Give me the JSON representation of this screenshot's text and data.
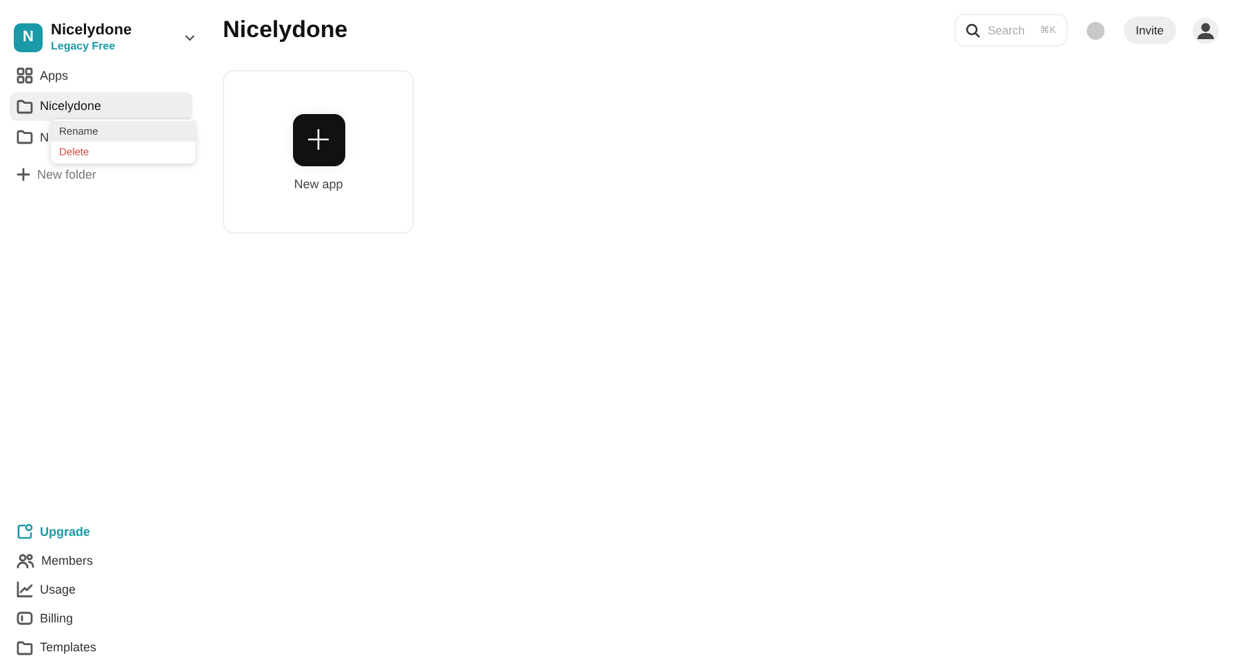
{
  "workspace": {
    "initial": "N",
    "name": "Nicelydone",
    "plan": "Legacy Free"
  },
  "nav": [
    {
      "label": "Apps",
      "selected": false
    },
    {
      "label": "Nicelydone",
      "selected": true
    },
    {
      "label": "N",
      "selected": false
    }
  ],
  "new_folder": {
    "label": "New folder"
  },
  "context_menu": [
    {
      "label": "Rename",
      "selected": true,
      "kind": "normal"
    },
    {
      "label": "Delete",
      "selected": false,
      "kind": "danger"
    }
  ],
  "bottom_nav": [
    {
      "label": "Upgrade",
      "highlighted": true
    },
    {
      "label": "Members",
      "highlighted": false
    },
    {
      "label": "Usage",
      "highlighted": false
    },
    {
      "label": "Billing",
      "highlighted": false
    },
    {
      "label": "Templates",
      "highlighted": false
    }
  ],
  "page_title": "Nicelydone",
  "search": {
    "placeholder": "Search",
    "shortcut": "⌘K"
  },
  "invite_button": "Invite",
  "new_app_card": {
    "label": "New app"
  }
}
